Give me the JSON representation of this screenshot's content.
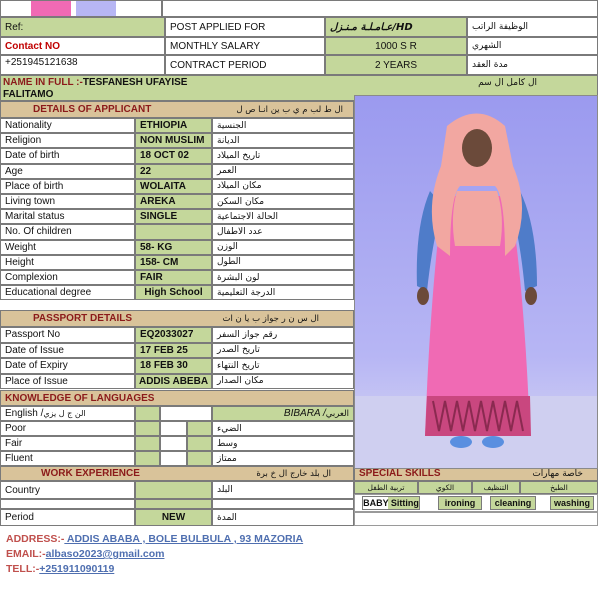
{
  "header": {
    "ref_label": "Ref:",
    "contact_label": "Contact NO",
    "contact_number": "+251945121638",
    "post_applied_label": "POST APPLIED FOR",
    "post_value": "HD/عـامـلـة مـنـزل",
    "monthly_salary_label": "MONTHLY SALARY",
    "monthly_salary_value": "1000 S R",
    "contract_period_label": "CONTRACT PERIOD",
    "contract_period_value": "2 YEARS",
    "post_ar": "الوظيفة الراتب",
    "salary_ar": "الشهري",
    "period_ar": "مدة العقد"
  },
  "name": {
    "label": "NAME IN FULL :-",
    "value_line1": "TESFANESH UFAYISE",
    "value_line2": "FALITAMO",
    "ar": "ال كامل ال سم"
  },
  "applicant": {
    "title": "DETAILS OF APPLICANT",
    "title_ar": "ال ط لب م ي ب ين  انـا ص ل",
    "rows": [
      {
        "label": "Nationality",
        "value": "ETHIOPIA",
        "ar": "الجنسية"
      },
      {
        "label": "Religion",
        "value": "NON MUSLIM",
        "ar": "الديانة"
      },
      {
        "label": "Date of birth",
        "value": "18 OCT 02",
        "ar": "تاريخ الميلاد"
      },
      {
        "label": "Age",
        "value": "22",
        "ar": "العمر"
      },
      {
        "label": "Place of birth",
        "value": "WOLAITA",
        "ar": "مكان الميلاد"
      },
      {
        "label": "Living town",
        "value": "AREKA",
        "ar": "مكان السكن"
      },
      {
        "label": "Marital status",
        "value": "SINGLE",
        "ar": "الحالة الاجتماعية"
      },
      {
        "label": "No. Of children",
        "value": "",
        "ar": "عدد الاطفال"
      },
      {
        "label": "Weight",
        "value": "58- KG",
        "ar": "الوزن"
      },
      {
        "label": "Height",
        "value": "158- CM",
        "ar": "الطول"
      },
      {
        "label": "Complexion",
        "value": "FAIR",
        "ar": "لون البشرة"
      },
      {
        "label": "Educational degree",
        "value": "High School",
        "ar": "الدرجة التعليمية"
      }
    ]
  },
  "passport": {
    "title": "PASSPORT DETAILS",
    "title_ar": "ال س ن ر جواز ب  يا ن ات",
    "rows": [
      {
        "label": "Passport No",
        "value": "EQ2033027",
        "ar": "رقم جواز السفر"
      },
      {
        "label": "Date of Issue",
        "value": "17 FEB 25",
        "ar": "تاريخ الصدر"
      },
      {
        "label": "Date of Expiry",
        "value": "18 FEB 30",
        "ar": "تاريخ النتهاء"
      },
      {
        "label": "Place of Issue",
        "value": "ADDIS ABEBA",
        "ar": "مكان الصدار"
      }
    ]
  },
  "languages": {
    "title": "KNOWLEDGE OF LANGUAGES",
    "english_label": "English / ",
    "english_ar": "الن ج ل يزي",
    "arabic_label": "BIBARA / ",
    "arabic_ar": "العربي",
    "levels": [
      {
        "label": "Poor",
        "ar": "الضيء"
      },
      {
        "label": "Fair",
        "ar": "وسط"
      },
      {
        "label": "Fluent",
        "ar": "ممتاز"
      }
    ]
  },
  "work": {
    "title": "WORK EXPERIENCE",
    "title_ar": "ال  بلد خارج ال خ برة",
    "country_label": "Country",
    "country_ar": "البلد",
    "period_label": "Period",
    "period_value": "NEW",
    "period_ar": "المدة"
  },
  "skills": {
    "title": "SPECIAL SKILLS",
    "title_ar": "خاصة مهارات",
    "ar_items": [
      "تربية الطفل",
      "الكوي",
      "التنظيف",
      "الطبخ"
    ],
    "items": [
      "BABY Sitting",
      "ironing",
      "cleaning",
      "washing"
    ]
  },
  "contact": {
    "address_label": "ADDRESS:-",
    "address_value": " ADDIS ABABA ,  BOLE  BULBULA  , 93 MAZORIA",
    "email_label": "EMAIL:-",
    "email_value": "albaso2023@gmail.com",
    "tel_label": "TELL:-",
    "tel_value": "+251911090119"
  },
  "colors": {
    "green": "#c4d79b",
    "tan": "#d9c39a",
    "dress": "#f06ab4",
    "scarf": "#f2a7a1"
  }
}
